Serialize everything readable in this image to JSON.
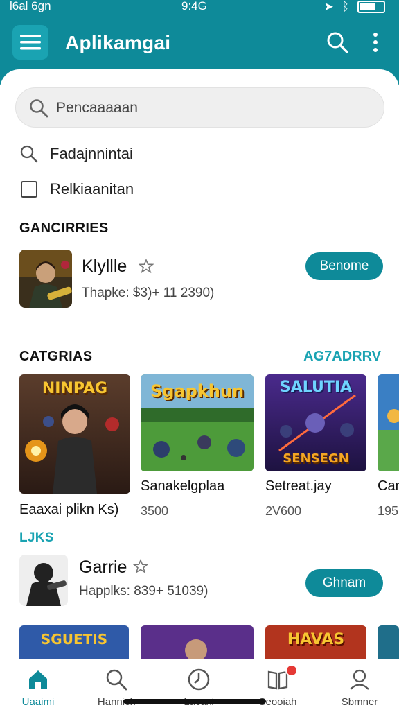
{
  "status_bar": {
    "left": "l6al 6gn",
    "time": "9:4G"
  },
  "app_bar": {
    "title": "Aplikamgai"
  },
  "search": {
    "placeholder": "Pencaaaaan"
  },
  "options": [
    {
      "label": "Fadajnnintai",
      "icon": "search-icon"
    },
    {
      "label": "Relkiaanitan",
      "icon": "checkbox"
    }
  ],
  "section1": {
    "title": "GANCIRRIES"
  },
  "featured_app": {
    "name": "Klyllle",
    "meta": "Thapke: $3)+ 11 2390)",
    "button": "Benome"
  },
  "section2": {
    "title": "CATGRIAS",
    "link": "AG7ADRRV"
  },
  "cards": [
    {
      "art_text": "NINPAG",
      "name": "Eaaxai plikn Ks)",
      "value": ""
    },
    {
      "art_text": "Sgapkhun",
      "name": "Sanakelgplaa",
      "value": "3500"
    },
    {
      "art_text": "SENSEGN",
      "name": "Setreat.jay",
      "value": "2V600"
    },
    {
      "art_text": "",
      "name": "Car",
      "value": "195"
    }
  ],
  "section3": {
    "title": "LJKS"
  },
  "second_app": {
    "name": "Garrie",
    "meta": "Happlks: 839+ 51039)",
    "button": "Ghnam"
  },
  "bottom_art": [
    "SGUETIS",
    "",
    "HAVAS",
    ""
  ],
  "bottom_nav": [
    {
      "label": "Uaaimi",
      "icon": "home-icon"
    },
    {
      "label": "Hannick",
      "icon": "search-icon"
    },
    {
      "label": "Lacaxi",
      "icon": "clock-icon"
    },
    {
      "label": "Seooiah",
      "icon": "book-icon"
    },
    {
      "label": "Sbmner",
      "icon": "profile-icon"
    }
  ],
  "colors": {
    "primary": "#0e8a99",
    "accent": "#1aa3b2",
    "badge": "#e53935"
  }
}
